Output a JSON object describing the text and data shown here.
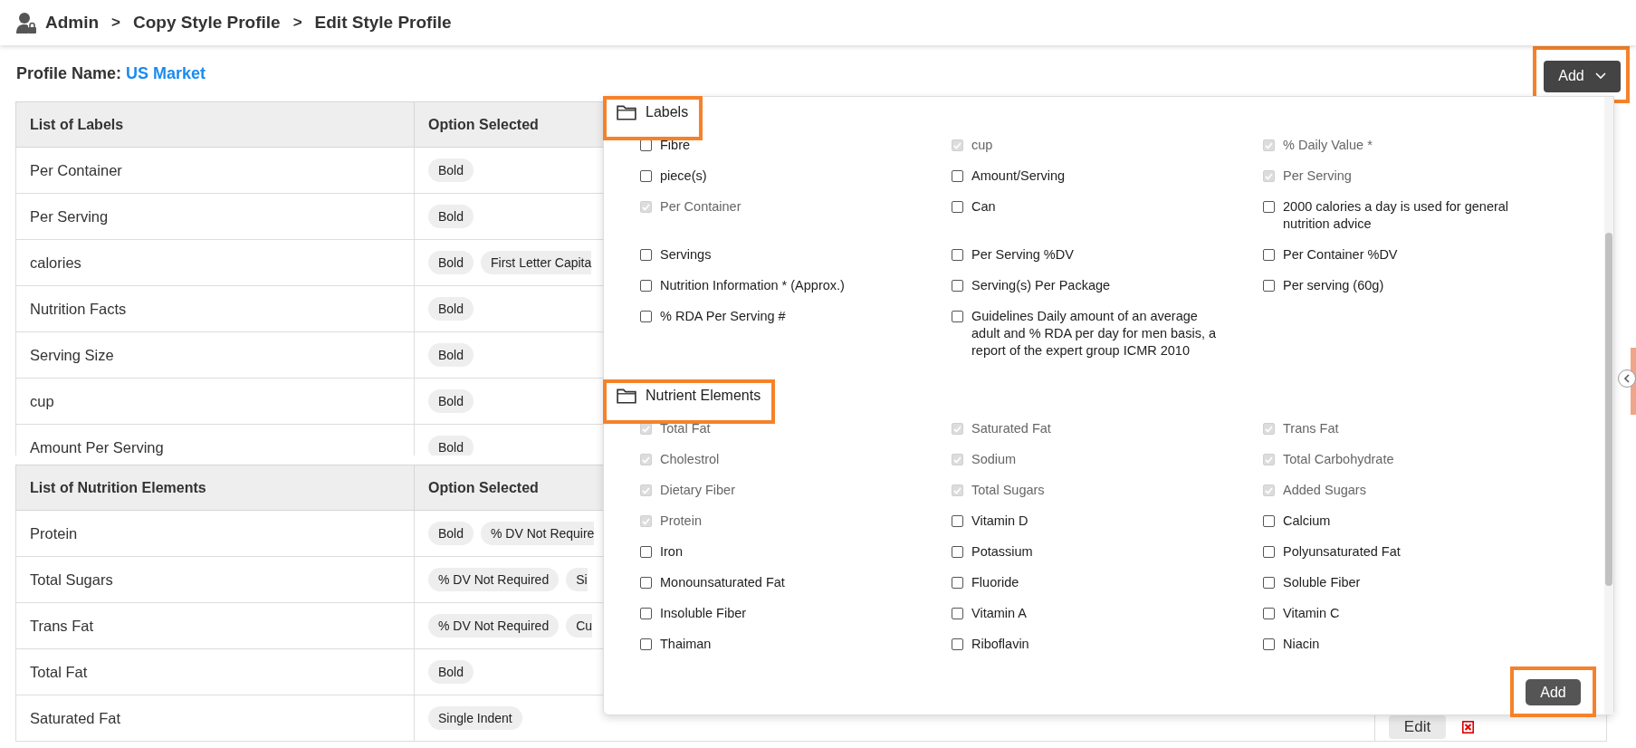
{
  "breadcrumb": [
    "Admin",
    "Copy Style Profile",
    "Edit Style Profile"
  ],
  "breadcrumb_separator": ">",
  "profile": {
    "label": "Profile Name:",
    "value": "US Market"
  },
  "add_menu": {
    "label": "Add",
    "highlighted": true
  },
  "tables": [
    {
      "columns": [
        "List of Labels",
        "Option Selected"
      ],
      "rows": [
        {
          "name": "Per Container",
          "options": [
            "Bold"
          ]
        },
        {
          "name": "Per Serving",
          "options": [
            "Bold"
          ]
        },
        {
          "name": "calories",
          "options": [
            "Bold",
            "First Letter Capita"
          ]
        },
        {
          "name": "Nutrition Facts",
          "options": [
            "Bold"
          ]
        },
        {
          "name": "Serving Size",
          "options": [
            "Bold"
          ]
        },
        {
          "name": "cup",
          "options": [
            "Bold"
          ]
        },
        {
          "name": "Amount Per Serving",
          "options": [
            "Bold"
          ]
        }
      ]
    },
    {
      "columns": [
        "List of Nutrition Elements",
        "Option Selected"
      ],
      "rows": [
        {
          "name": "Protein",
          "options": [
            "Bold",
            "% DV Not Require"
          ]
        },
        {
          "name": "Total Sugars",
          "options": [
            "% DV Not Required",
            "Si"
          ]
        },
        {
          "name": "Trans Fat",
          "options": [
            "% DV Not Required",
            "Cu"
          ]
        },
        {
          "name": "Total Fat",
          "options": [
            "Bold"
          ]
        },
        {
          "name": "Saturated Fat",
          "options": [
            "Single Indent"
          ],
          "actions": {
            "edit": "Edit",
            "delete": true
          }
        }
      ]
    }
  ],
  "dropdown": {
    "sections": [
      {
        "title": "Labels",
        "highlighted": true,
        "items": [
          {
            "label": "Fibre",
            "checked": false
          },
          {
            "label": "cup",
            "checked": true
          },
          {
            "label": "% Daily Value *",
            "checked": true
          },
          {
            "label": "piece(s)",
            "checked": false
          },
          {
            "label": "Amount/Serving",
            "checked": false
          },
          {
            "label": "Per Serving",
            "checked": true
          },
          {
            "label": "Per Container",
            "checked": true
          },
          {
            "label": "Can",
            "checked": false
          },
          {
            "label": "2000 calories a day is used for general nutrition advice",
            "checked": false
          },
          {
            "label": "Servings",
            "checked": false
          },
          {
            "label": "Per Serving %DV",
            "checked": false
          },
          {
            "label": "Per Container %DV",
            "checked": false
          },
          {
            "label": "Nutrition Information * (Approx.)",
            "checked": false
          },
          {
            "label": "Serving(s) Per Package",
            "checked": false
          },
          {
            "label": "Per serving (60g)",
            "checked": false
          },
          {
            "label": "% RDA Per Serving #",
            "checked": false
          },
          {
            "label": "Guidelines Daily amount of an average adult and % RDA per day for men basis, a report of the expert group ICMR 2010",
            "checked": false
          }
        ]
      },
      {
        "title": "Nutrient Elements",
        "highlighted": true,
        "items": [
          {
            "label": "Total Fat",
            "checked": true
          },
          {
            "label": "Saturated Fat",
            "checked": true
          },
          {
            "label": "Trans Fat",
            "checked": true
          },
          {
            "label": "Cholestrol",
            "checked": true
          },
          {
            "label": "Sodium",
            "checked": true
          },
          {
            "label": "Total Carbohydrate",
            "checked": true
          },
          {
            "label": "Dietary Fiber",
            "checked": true
          },
          {
            "label": "Total Sugars",
            "checked": true
          },
          {
            "label": "Added Sugars",
            "checked": true
          },
          {
            "label": "Protein",
            "checked": true
          },
          {
            "label": "Vitamin D",
            "checked": false
          },
          {
            "label": "Calcium",
            "checked": false
          },
          {
            "label": "Iron",
            "checked": false
          },
          {
            "label": "Potassium",
            "checked": false
          },
          {
            "label": "Polyunsaturated Fat",
            "checked": false
          },
          {
            "label": "Monounsaturated Fat",
            "checked": false
          },
          {
            "label": "Fluoride",
            "checked": false
          },
          {
            "label": "Soluble Fiber",
            "checked": false
          },
          {
            "label": "Insoluble Fiber",
            "checked": false
          },
          {
            "label": "Vitamin A",
            "checked": false
          },
          {
            "label": "Vitamin C",
            "checked": false
          },
          {
            "label": "Thaiman",
            "checked": false
          },
          {
            "label": "Riboflavin",
            "checked": false
          },
          {
            "label": "Niacin",
            "checked": false
          }
        ]
      }
    ],
    "submit": {
      "label": "Add",
      "highlighted": true
    }
  }
}
